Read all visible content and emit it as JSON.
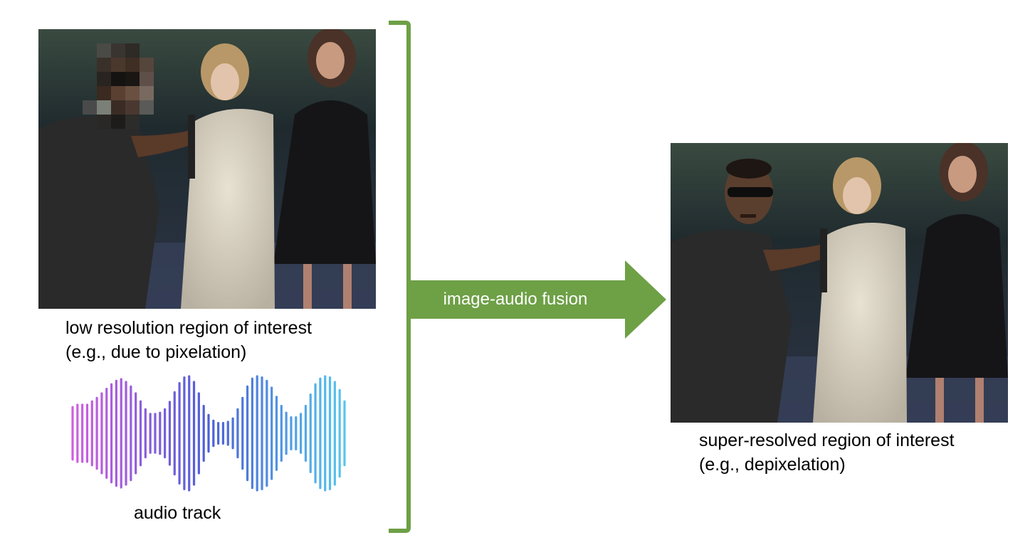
{
  "left_panel": {
    "image_name": "pixelated-stage-photo",
    "caption_line1": "low resolution region of interest",
    "caption_line2": "(e.g., due to pixelation)"
  },
  "audio": {
    "label": "audio track",
    "gradient_start": "#d45ee0",
    "gradient_mid": "#4b5fd6",
    "gradient_end": "#56c8ee",
    "bar_amplitudes": [
      0.46,
      0.5,
      0.5,
      0.5,
      0.56,
      0.62,
      0.7,
      0.78,
      0.86,
      0.92,
      0.95,
      0.9,
      0.82,
      0.7,
      0.56,
      0.42,
      0.34,
      0.34,
      0.36,
      0.42,
      0.55,
      0.72,
      0.88,
      0.98,
      1.0,
      0.9,
      0.7,
      0.48,
      0.32,
      0.22,
      0.18,
      0.18,
      0.2,
      0.26,
      0.42,
      0.62,
      0.82,
      0.96,
      1.0,
      0.98,
      0.92,
      0.8,
      0.64,
      0.48,
      0.36,
      0.28,
      0.28,
      0.34,
      0.48,
      0.68,
      0.86,
      0.96,
      1.0,
      0.98,
      0.9,
      0.76,
      0.56
    ]
  },
  "fusion": {
    "label": "image-audio fusion",
    "color": "#6ea046"
  },
  "right_panel": {
    "image_name": "super-resolved-stage-photo",
    "caption_line1": "super-resolved region of interest",
    "caption_line2": "(e.g., depixelation)"
  }
}
